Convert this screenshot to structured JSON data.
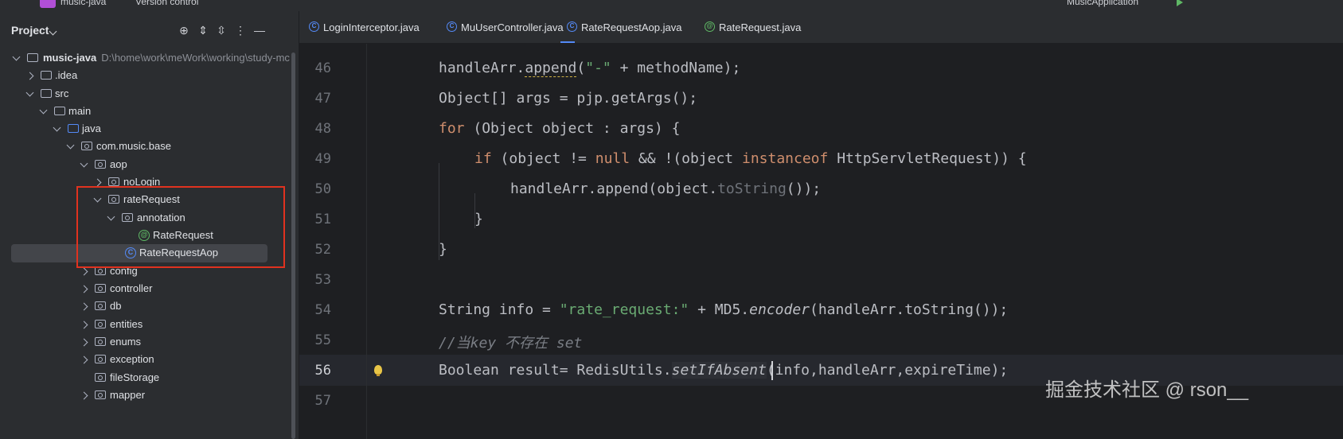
{
  "titlebar": {
    "project": "music-java",
    "vcs": "Version control",
    "run_config": "MusicApplication"
  },
  "project_panel": {
    "title": "Project",
    "tree": [
      {
        "label": "music-java",
        "path": "D:\\home\\work\\meWork\\working\\study-mc",
        "icon": "folder-icon"
      },
      {
        "label": ".idea",
        "icon": "folder-icon"
      },
      {
        "label": "src",
        "icon": "folder-icon"
      },
      {
        "label": "main",
        "icon": "folder-icon"
      },
      {
        "label": "java",
        "icon": "folder-icon"
      },
      {
        "label": "com.music.base",
        "icon": "package-icon"
      },
      {
        "label": "aop",
        "icon": "package-icon"
      },
      {
        "label": "noLogin",
        "icon": "package-icon"
      },
      {
        "label": "rateRequest",
        "icon": "package-icon"
      },
      {
        "label": "annotation",
        "icon": "package-icon"
      },
      {
        "label": "RateRequest",
        "icon": "annotation-icon"
      },
      {
        "label": "RateRequestAop",
        "icon": "class-icon"
      },
      {
        "label": "config",
        "icon": "package-icon"
      },
      {
        "label": "controller",
        "icon": "package-icon"
      },
      {
        "label": "db",
        "icon": "package-icon"
      },
      {
        "label": "entities",
        "icon": "package-icon"
      },
      {
        "label": "enums",
        "icon": "package-icon"
      },
      {
        "label": "exception",
        "icon": "package-icon"
      },
      {
        "label": "fileStorage",
        "icon": "package-icon"
      },
      {
        "label": "mapper",
        "icon": "package-icon"
      }
    ]
  },
  "tabs": [
    {
      "label": "LoginInterceptor.java",
      "icon": "class-icon"
    },
    {
      "label": "MuUserController.java",
      "icon": "class-icon"
    },
    {
      "label": "RateRequestAop.java",
      "icon": "class-icon",
      "active": true
    },
    {
      "label": "RateRequest.java",
      "icon": "annotation-icon"
    }
  ],
  "editor": {
    "line_numbers": [
      "46",
      "47",
      "48",
      "49",
      "50",
      "51",
      "52",
      "53",
      "54",
      "55",
      "56",
      "57"
    ],
    "lines": {
      "l46": {
        "a": "handleArr.",
        "b": "append",
        "c": "(",
        "d": "\"-\"",
        "e": " + methodName);"
      },
      "l47": {
        "a": "Object[] args = pjp.getArgs();"
      },
      "l48": {
        "kw": "for",
        "a": " (Object object : args) {"
      },
      "l49": {
        "kw": "if",
        "a": " (object != ",
        "null": "null",
        "b": " && !(object ",
        "inst": "instanceof",
        "c": " HttpServletRequest)) {"
      },
      "l50": {
        "a": "handleArr.append(object.",
        "m": "toString",
        "b": "());"
      },
      "l51": {
        "a": "}"
      },
      "l52": {
        "a": "}"
      },
      "l53": {
        "a": ""
      },
      "l54": {
        "a": "String info = ",
        "str": "\"rate_request:\"",
        "b": " + MD5.",
        "it": "encoder",
        "c": "(handleArr.toString());"
      },
      "l55": {
        "cmt": "//当key 不存在 set"
      },
      "l56": {
        "a": "Boolean result= RedisUtils.",
        "it": "setIfAbsent",
        "b": "(info,handleArr,expireTime);"
      }
    }
  },
  "watermark": "掘金技术社区 @ rson__",
  "colors": {
    "accent": "#548af7",
    "highlight_box": "#e0321f",
    "keyword": "#cf8e6d",
    "string": "#6aab73"
  }
}
